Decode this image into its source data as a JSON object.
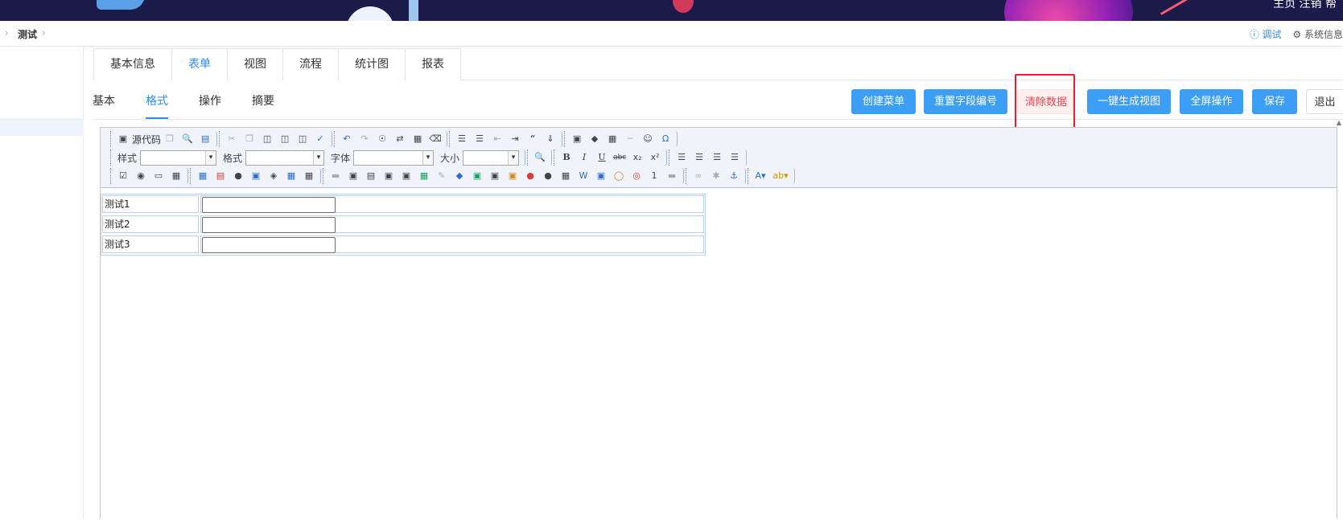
{
  "header": {
    "top_links": "主页  注销  帮"
  },
  "breadcrumb": {
    "current": "测试"
  },
  "header_actions": {
    "debug_label": "调试",
    "system_label": "系统信息"
  },
  "main_tabs": [
    {
      "label": "基本信息",
      "active": false
    },
    {
      "label": "表单",
      "active": true
    },
    {
      "label": "视图",
      "active": false
    },
    {
      "label": "流程",
      "active": false
    },
    {
      "label": "统计图",
      "active": false
    },
    {
      "label": "报表",
      "active": false
    }
  ],
  "sub_tabs": [
    {
      "label": "基本",
      "active": false
    },
    {
      "label": "格式",
      "active": true
    },
    {
      "label": "操作",
      "active": false
    },
    {
      "label": "摘要",
      "active": false
    }
  ],
  "actions": {
    "create_menu": "创建菜单",
    "reset_field_numbers": "重置字段编号",
    "clear_data": "清除数据",
    "generate_view": "一键生成视图",
    "fullscreen": "全屏操作",
    "save": "保存",
    "exit": "退出"
  },
  "toolbar": {
    "source_label": "源代码",
    "style_label": "样式",
    "format_label": "格式",
    "font_label": "字体",
    "size_label": "大小"
  },
  "form_rows": [
    {
      "label": "测试1",
      "value": ""
    },
    {
      "label": "测试2",
      "value": ""
    },
    {
      "label": "测试3",
      "value": ""
    }
  ],
  "colors": {
    "primary": "#3c9ef5",
    "danger": "#e9474f",
    "highlight": "#e8222b",
    "banner": "#1c1a4a"
  }
}
